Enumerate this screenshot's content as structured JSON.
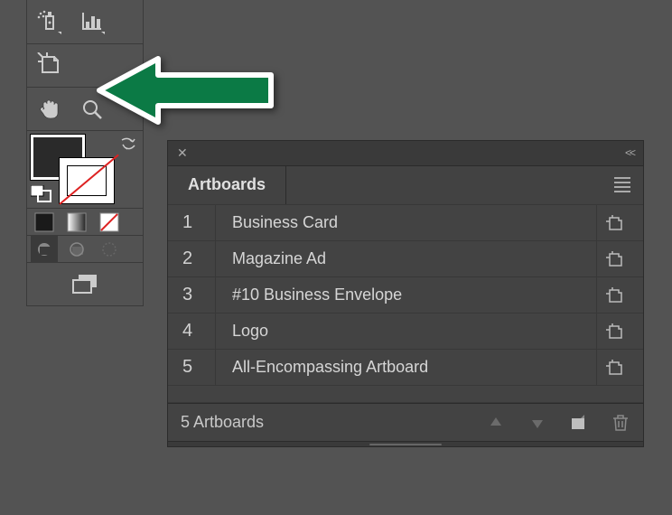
{
  "panel": {
    "tab_title": "Artboards",
    "artboards": [
      {
        "num": "1",
        "name": "Business Card"
      },
      {
        "num": "2",
        "name": "Magazine Ad"
      },
      {
        "num": "3",
        "name": "#10 Business Envelope"
      },
      {
        "num": "4",
        "name": "Logo"
      },
      {
        "num": "5",
        "name": "All-Encompassing Artboard"
      }
    ],
    "footer_count": "5 Artboards"
  },
  "tools": {
    "row1": [
      "spray-tool",
      "graph-tool"
    ],
    "row2": [
      "artboard-tool"
    ],
    "row3": [
      "hand-tool",
      "zoom-tool"
    ]
  }
}
